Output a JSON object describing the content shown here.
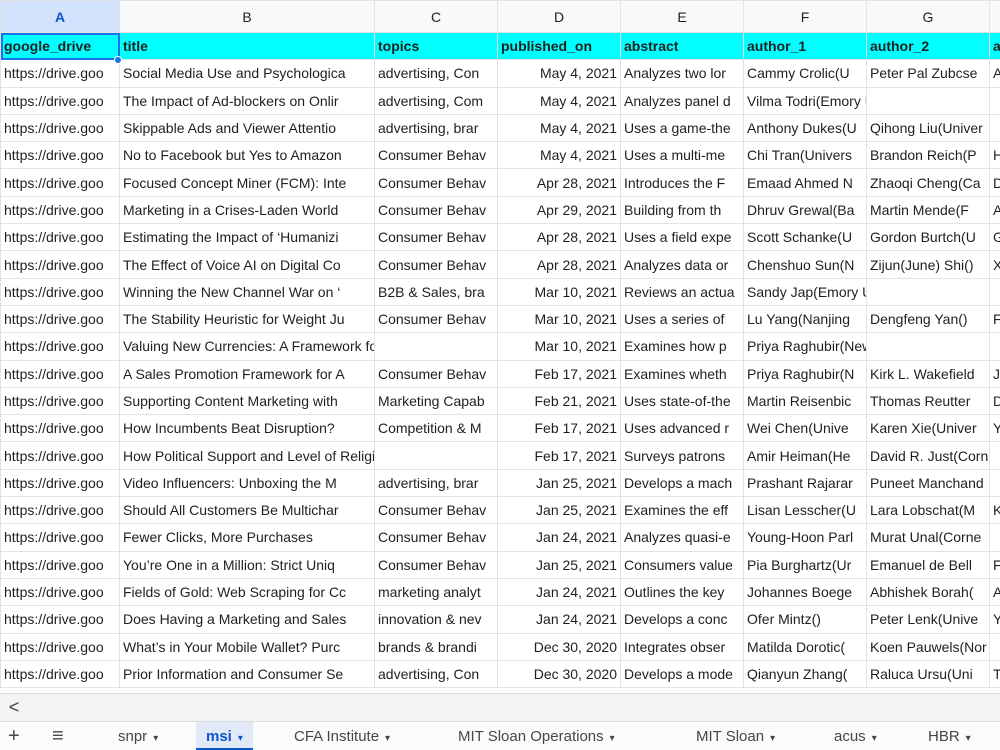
{
  "columns": [
    "A",
    "B",
    "C",
    "D",
    "E",
    "F",
    "G",
    ""
  ],
  "header_row": [
    "google_drive",
    "title",
    "topics",
    "published_on",
    "abstract",
    "author_1",
    "author_2",
    "a"
  ],
  "rows": [
    [
      "https://drive.goo",
      "Social Media Use and Psychologica",
      "advertising, Con",
      "May 4, 2021",
      "Analyzes two lor",
      "Cammy Crolic(U",
      "Peter Pal Zubcse",
      "A"
    ],
    [
      "https://drive.goo",
      "The Impact of Ad-blockers on Onlir",
      "advertising, Com",
      "May 4, 2021",
      "Analyzes panel d",
      "Vilma Todri(Emory University)",
      "",
      ""
    ],
    [
      "https://drive.goo",
      "Skippable Ads and Viewer Attentio",
      "advertising, brar",
      "May 4, 2021",
      "Uses a game-the",
      "Anthony Dukes(U",
      "Qihong Liu(Univer",
      ""
    ],
    [
      "https://drive.goo",
      "No to Facebook but Yes to Amazon",
      "Consumer Behav",
      "May 4, 2021",
      "Uses a multi-me",
      "Chi Tran(Univers",
      "Brandon Reich(P",
      "H"
    ],
    [
      "https://drive.goo",
      "Focused Concept Miner (FCM): Inte",
      "Consumer Behav",
      "Apr 28, 2021",
      "Introduces the F",
      "Emaad Ahmed N",
      "Zhaoqi Cheng(Ca",
      "D"
    ],
    [
      "https://drive.goo",
      "Marketing in a Crises-Laden World",
      "Consumer Behav",
      "Apr 29, 2021",
      "Building from th",
      "Dhruv Grewal(Ba",
      "Martin Mende(F",
      "A"
    ],
    [
      "https://drive.goo",
      "Estimating the Impact of ‘Humanizi",
      "Consumer Behav",
      "Apr 28, 2021",
      "Uses a field expe",
      "Scott Schanke(U",
      "Gordon Burtch(U",
      "G"
    ],
    [
      "https://drive.goo",
      "The Effect of Voice AI on Digital Co",
      "Consumer Behav",
      "Apr 28, 2021",
      "Analyzes data or",
      "Chenshuo Sun(N",
      "Zijun(June) Shi()",
      "X"
    ],
    [
      "https://drive.goo",
      "Winning the New Channel War on ‘",
      "B2B & Sales, bra",
      "Mar 10, 2021",
      "Reviews an actua",
      "Sandy Jap(Emory University)",
      "",
      ""
    ],
    [
      "https://drive.goo",
      "The Stability Heuristic for Weight Ju",
      "Consumer Behav",
      "Mar 10, 2021",
      "Uses a series of",
      "Lu Yang(Nanjing",
      "Dengfeng Yan()",
      "F"
    ],
    [
      "https://drive.goo",
      "Valuing New Currencies: A Framework for Future Re",
      "",
      "Mar 10, 2021",
      "Examines how p",
      "Priya Raghubir(New York University",
      "",
      ""
    ],
    [
      "https://drive.goo",
      "A Sales Promotion Framework for A",
      "Consumer Behav",
      "Feb 17, 2021",
      "Examines wheth",
      "Priya Raghubir(N",
      "Kirk L. Wakefield",
      "J"
    ],
    [
      "https://drive.goo",
      "Supporting Content Marketing with",
      "Marketing Capab",
      "Feb 21, 2021",
      "Uses state-of-the",
      "Martin Reisenbic",
      "Thomas Reutter",
      "D"
    ],
    [
      "https://drive.goo",
      "How Incumbents Beat Disruption?",
      "Competition & M",
      "Feb 17, 2021",
      "Uses advanced r",
      "Wei Chen(Unive",
      "Karen Xie(Univer",
      "Y"
    ],
    [
      "https://drive.goo",
      "How Political Support and Level of Religiosity Affect",
      "",
      "Feb 17, 2021",
      "Surveys patrons",
      "Amir Heiman(He",
      "David R. Just(Corn",
      ""
    ],
    [
      "https://drive.goo",
      "Video Influencers: Unboxing the M",
      "advertising, brar",
      "Jan 25, 2021",
      "Develops a mach",
      "Prashant Rajarar",
      "Puneet Manchand",
      ""
    ],
    [
      "https://drive.goo",
      "Should All Customers Be Multichar",
      "Consumer Behav",
      "Jan 25, 2021",
      "Examines the eff",
      "Lisan Lesscher(U",
      "Lara Lobschat(M",
      "K"
    ],
    [
      "https://drive.goo",
      "Fewer Clicks, More Purchases",
      "Consumer Behav",
      "Jan 24, 2021",
      "Analyzes quasi-e",
      "Young-Hoon Parl",
      "Murat Unal(Corne",
      ""
    ],
    [
      "https://drive.goo",
      "You’re One in a Million: Strict Uniq",
      "Consumer Behav",
      "Jan 25, 2021",
      "Consumers value",
      "Pia Burghartz(Ur",
      "Emanuel de Bell",
      "F"
    ],
    [
      "https://drive.goo",
      "Fields of Gold: Web Scraping for Cc",
      "marketing analyt",
      "Jan 24, 2021",
      "Outlines the key",
      "Johannes Boege",
      "Abhishek Borah(",
      "A"
    ],
    [
      "https://drive.goo",
      "Does Having a Marketing and Sales",
      "innovation & nev",
      "Jan 24, 2021",
      "Develops a conc",
      "Ofer Mintz()",
      "Peter Lenk(Unive",
      "Y"
    ],
    [
      "https://drive.goo",
      "What’s in Your Mobile Wallet? Purc",
      "brands & brandi",
      "Dec 30, 2020",
      "Integrates obser",
      "Matilda Dorotic(",
      "Koen Pauwels(Nor",
      ""
    ],
    [
      "https://drive.goo",
      "Prior Information and Consumer Se",
      "advertising, Con",
      "Dec 30, 2020",
      "Develops a mode",
      "Qianyun Zhang(",
      "Raluca Ursu(Uni",
      "T"
    ]
  ],
  "scroll_left_glyph": "<",
  "sheet_controls": {
    "add": "+",
    "menu": "≡"
  },
  "tabs": [
    {
      "label": "snpr",
      "active": false
    },
    {
      "label": "msi",
      "active": true
    },
    {
      "label": "CFA Institute",
      "active": false
    },
    {
      "label": "MIT Sloan Operations",
      "active": false
    },
    {
      "label": "MIT Sloan",
      "active": false
    },
    {
      "label": "acus",
      "active": false
    },
    {
      "label": "HBR",
      "active": false
    }
  ],
  "tab_caret": "▾",
  "colors": {
    "header_fill": "#00ffff",
    "selection": "#1a73e8",
    "active_tab": "#0b57d0"
  }
}
